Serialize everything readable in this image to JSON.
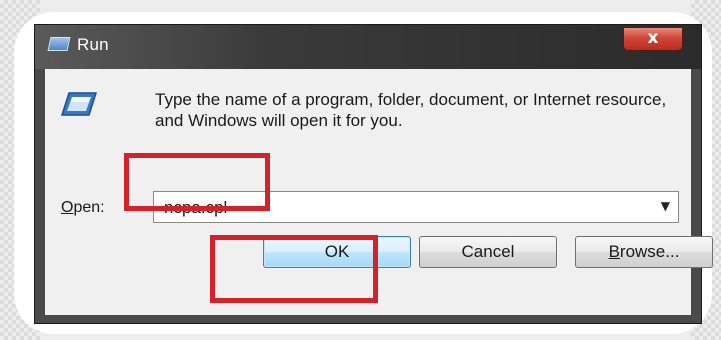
{
  "window": {
    "title": "Run",
    "close_glyph": "x"
  },
  "dialog": {
    "icon": "run-program-icon",
    "description": "Type the name of a program, folder, document, or Internet resource, and Windows will open it for you.",
    "open_label_accel": "O",
    "open_label_rest": "pen:",
    "open_value": "ncpa.cpl",
    "dropdown_glyph": "▼"
  },
  "buttons": {
    "ok": "OK",
    "cancel": "Cancel",
    "browse_accel": "B",
    "browse_rest": "rowse..."
  },
  "colors": {
    "highlight": "#d2232a",
    "title_bar": "#2b2b2b",
    "close_button": "#c0392b",
    "ok_button_border": "#3c7fb1"
  }
}
